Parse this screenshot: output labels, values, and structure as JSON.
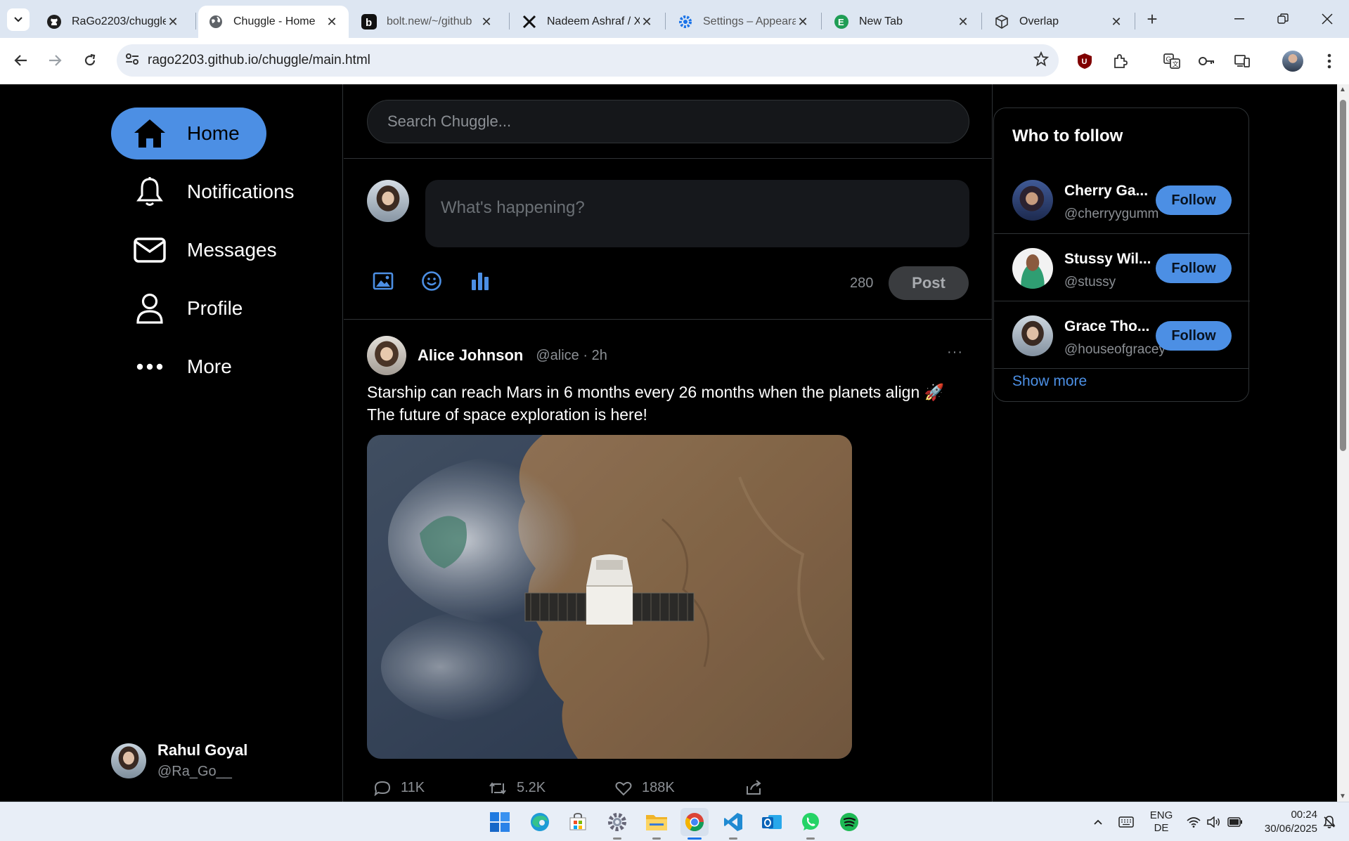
{
  "browser": {
    "tabs": [
      {
        "title": "RaGo2203/chuggle",
        "icon": "github-icon",
        "active": false
      },
      {
        "title": "Chuggle - Home",
        "icon": "globe-icon",
        "active": true
      },
      {
        "title": "bolt.new/~/github",
        "icon": "bolt-icon",
        "active": false
      },
      {
        "title": "Nadeem Ashraf / X",
        "icon": "x-logo-icon",
        "active": false
      },
      {
        "title": "Settings – Appeara",
        "icon": "settings-gear-icon",
        "active": false
      },
      {
        "title": "New Tab",
        "icon": "evernote-icon",
        "active": false
      },
      {
        "title": "Overlap",
        "icon": "overlap-cube-icon",
        "active": false
      }
    ],
    "url": "rago2203.github.io/chuggle/main.html"
  },
  "sidebar": {
    "items": [
      {
        "label": "Home",
        "icon": "home-icon",
        "active": true
      },
      {
        "label": "Notifications",
        "icon": "bell-icon",
        "active": false
      },
      {
        "label": "Messages",
        "icon": "mail-icon",
        "active": false
      },
      {
        "label": "Profile",
        "icon": "person-icon",
        "active": false
      },
      {
        "label": "More",
        "icon": "more-dots-icon",
        "active": false
      }
    ],
    "user": {
      "name": "Rahul Goyal",
      "handle": "@Ra_Go__"
    }
  },
  "search": {
    "placeholder": "Search Chuggle..."
  },
  "compose": {
    "placeholder": "What's happening?",
    "char_count": "280",
    "post_label": "Post",
    "tools": [
      "image-icon",
      "emoji-icon",
      "poll-chart-icon"
    ]
  },
  "post": {
    "author": "Alice Johnson",
    "meta": "@alice · 2h",
    "more": "···",
    "text_line1": "Starship can reach Mars in 6 months every 26 months when the planets align 🚀",
    "text_line2": "The future of space exploration is here!",
    "image_alt": "spacecraft over desert coast",
    "stats": {
      "replies": "11K",
      "reposts": "5.2K",
      "likes": "188K"
    }
  },
  "who_to_follow": {
    "title": "Who to follow",
    "people": [
      {
        "name": "Cherry Ga...",
        "handle": "@cherryygumm",
        "button": "Follow"
      },
      {
        "name": "Stussy Wil...",
        "handle": "@stussy",
        "button": "Follow"
      },
      {
        "name": "Grace Tho...",
        "handle": "@houseofgracey",
        "button": "Follow"
      }
    ],
    "show_more": "Show more"
  },
  "taskbar": {
    "lang_top": "ENG",
    "lang_bottom": "DE",
    "time": "00:24",
    "date": "30/06/2025"
  },
  "colors": {
    "accent": "#4c8fe4",
    "page_bg": "#000000",
    "muted": "#8b8f94"
  }
}
